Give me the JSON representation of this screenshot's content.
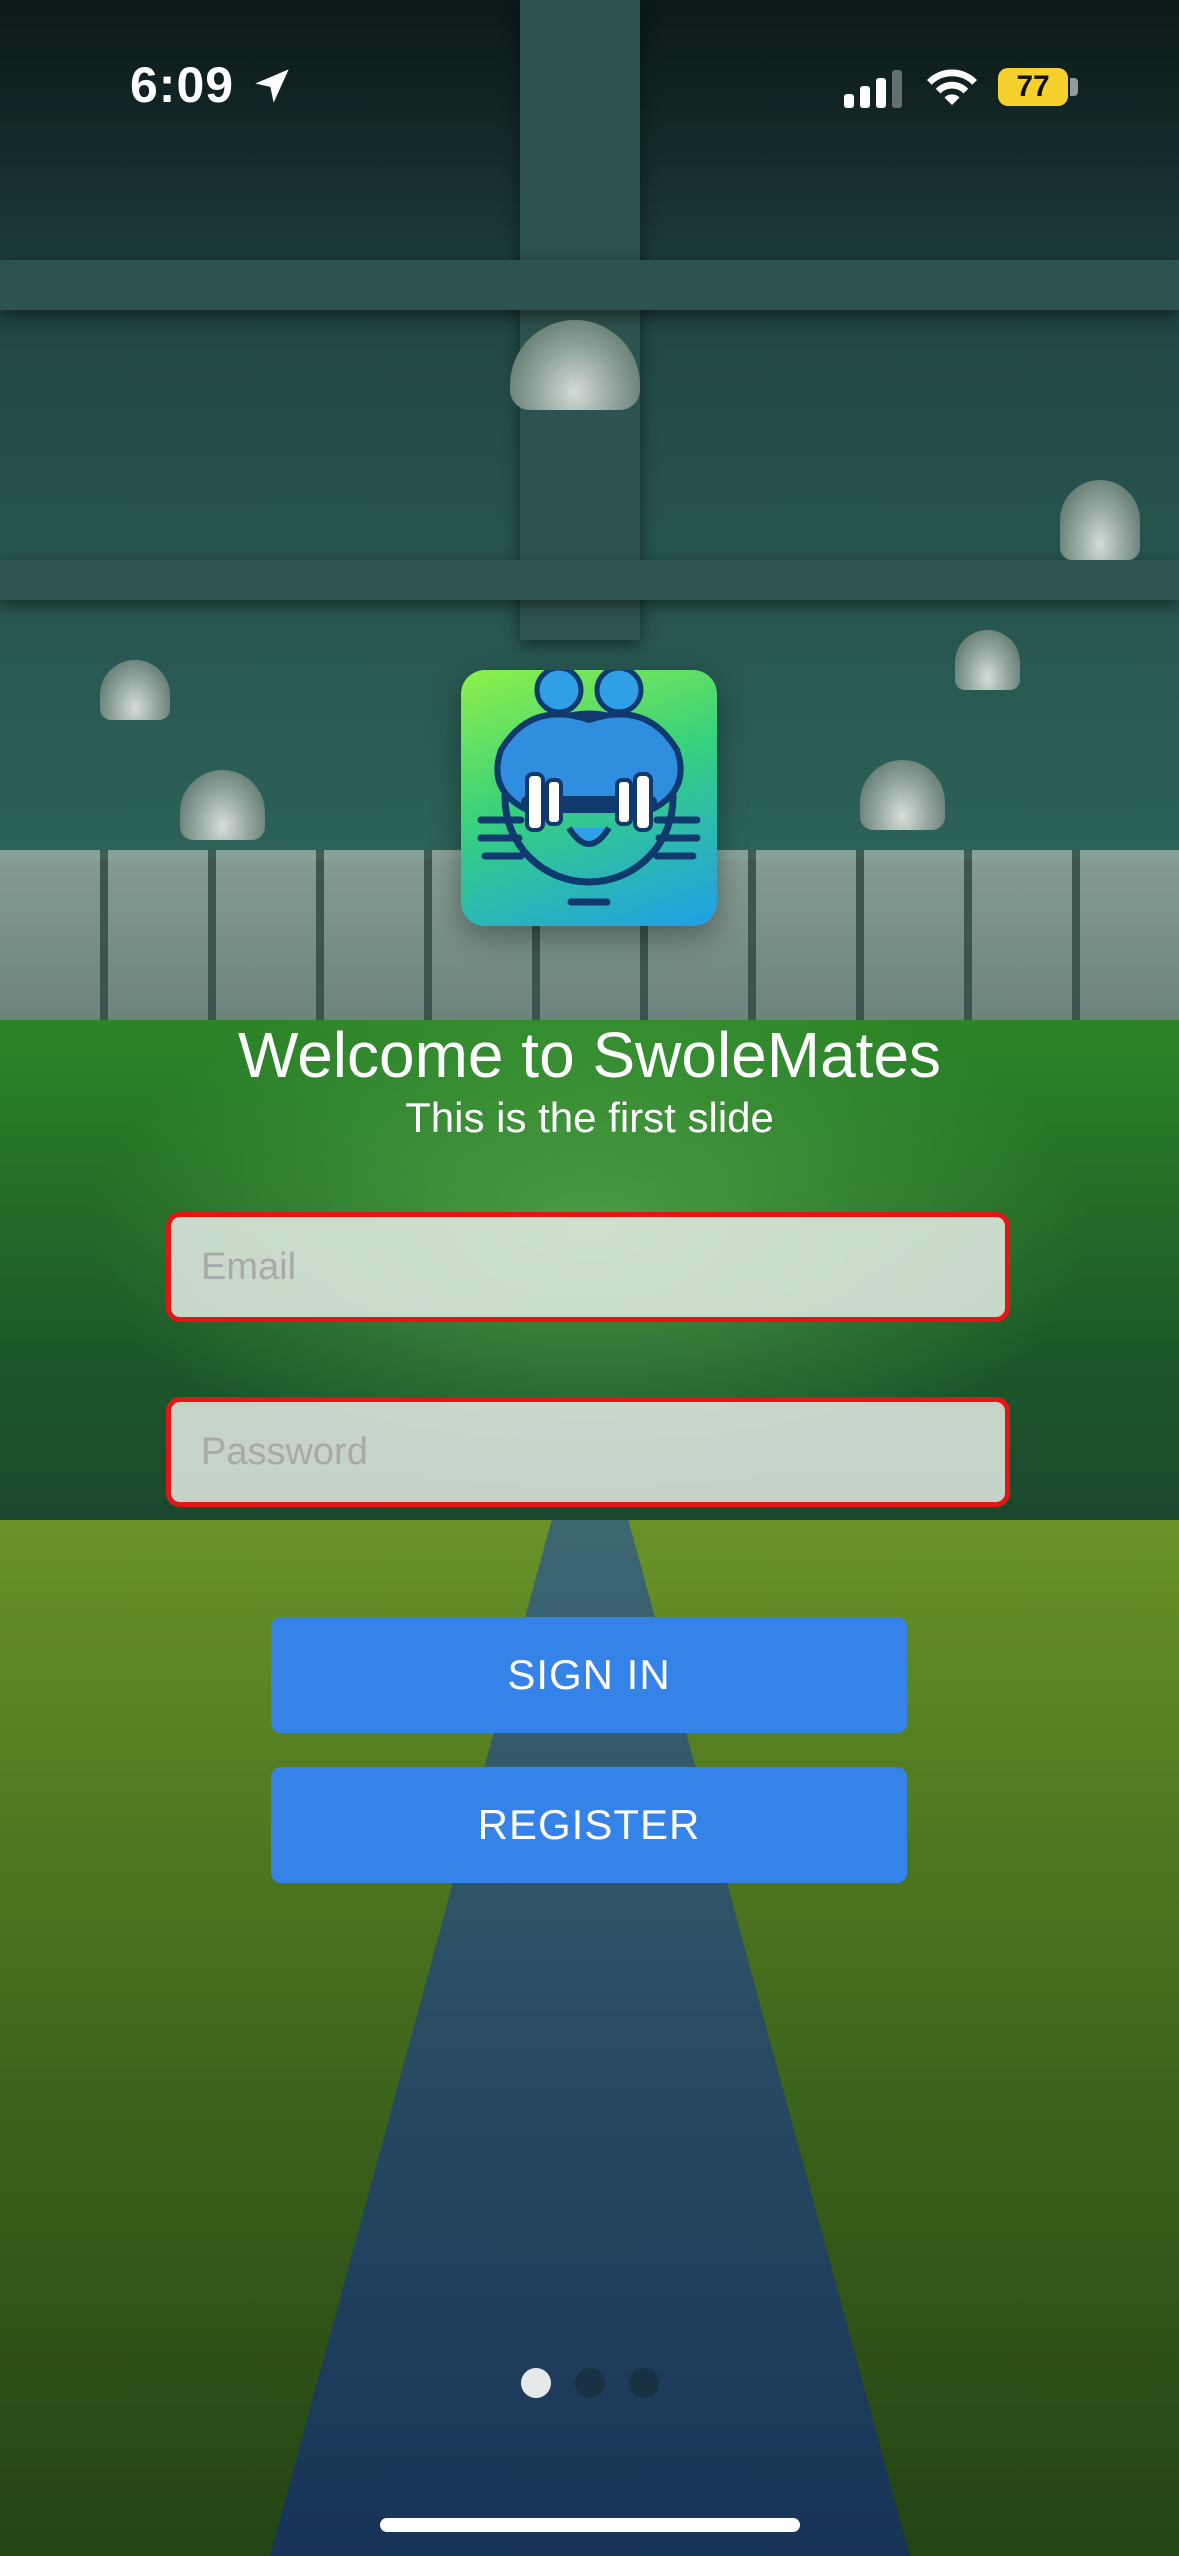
{
  "status_bar": {
    "time": "6:09",
    "battery": "77",
    "battery_color": "#f6d12d",
    "icons": [
      "location-arrow-icon",
      "cellular-signal-icon",
      "wifi-icon",
      "battery-icon"
    ]
  },
  "app": {
    "logo_icon": "swolemates-logo",
    "welcome": "Welcome to SwoleMates",
    "subtitle": "This is the first slide"
  },
  "form": {
    "email_placeholder": "Email",
    "email_value": "",
    "password_placeholder": "Password",
    "password_value": "",
    "error_border_color": "#e41515"
  },
  "buttons": {
    "sign_in": "SIGN IN",
    "register": "REGISTER",
    "color": "#3582e8"
  },
  "pager": {
    "current": 1,
    "total": 3
  }
}
